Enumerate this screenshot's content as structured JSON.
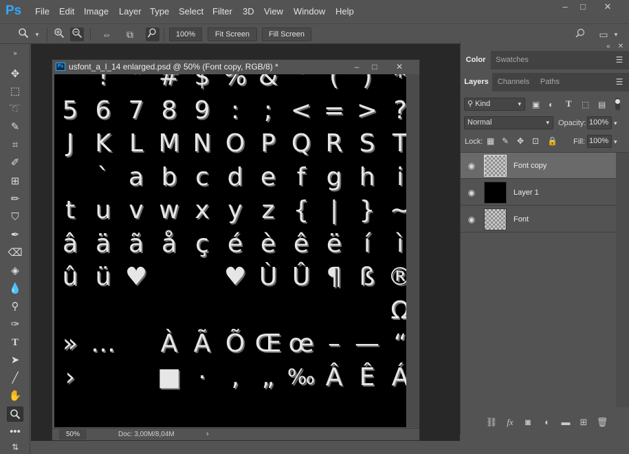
{
  "app": {
    "logo": "Ps"
  },
  "menu": [
    "File",
    "Edit",
    "Image",
    "Layer",
    "Type",
    "Select",
    "Filter",
    "3D",
    "View",
    "Window",
    "Help"
  ],
  "window_controls": [
    "–",
    "□",
    "✕"
  ],
  "options_bar": {
    "zoom_value": "100%",
    "fit_screen": "Fit Screen",
    "fill_screen": "Fill Screen"
  },
  "document": {
    "title": "usfont_a_l_14 enlarged.psd @ 50% (Font copy, RGB/8) *",
    "ps_icon": "Ps",
    "controls": [
      "–",
      "□",
      "✕"
    ],
    "status_zoom": "50%",
    "status_doc": "Doc: 3,00M/8,04M",
    "status_arrow": "›"
  },
  "glyph_rows": [
    [
      "",
      "!",
      "\"",
      "#",
      "$",
      "%",
      "&",
      "'",
      "(",
      ")",
      "*"
    ],
    [
      "5",
      "6",
      "7",
      "8",
      "9",
      ":",
      ";",
      "<",
      "=",
      ">",
      "?"
    ],
    [
      "J",
      "K",
      "L",
      "M",
      "N",
      "O",
      "P",
      "Q",
      "R",
      "S",
      "T"
    ],
    [
      "",
      "`",
      "a",
      "b",
      "c",
      "d",
      "e",
      "f",
      "g",
      "h",
      "i"
    ],
    [
      "t",
      "u",
      "v",
      "w",
      "x",
      "y",
      "z",
      "{",
      "|",
      "}",
      "~"
    ],
    [
      "â",
      "ä",
      "ã",
      "å",
      "ç",
      "é",
      "è",
      "ê",
      "ë",
      "í",
      "ì"
    ],
    [
      "û",
      "ü",
      "♥",
      "",
      "",
      "♥",
      "Ù",
      "Û",
      "¶",
      "ß",
      "®"
    ],
    [
      "",
      "",
      "",
      "",
      "",
      "",
      "",
      "",
      "",
      "",
      "Ω"
    ],
    [
      "»",
      "…",
      "",
      "À",
      "Ã",
      "Õ",
      "Œ",
      "œ",
      "–",
      "—",
      "“"
    ],
    [
      "›",
      "",
      "",
      "■",
      "·",
      "‚",
      "„",
      "‰",
      "Â",
      "Ê",
      "Á"
    ]
  ],
  "panels": {
    "top_tabs": [
      "Color",
      "Swatches"
    ],
    "layers_tabs": [
      "Layers",
      "Channels",
      "Paths"
    ],
    "filter_kind": "Kind",
    "blend_mode": "Normal",
    "opacity_label": "Opacity:",
    "opacity_value": "100%",
    "lock_label": "Lock:",
    "fill_label": "Fill:",
    "fill_value": "100%",
    "layers": [
      {
        "name": "Font copy",
        "thumb": "checker",
        "selected": true
      },
      {
        "name": "Layer 1",
        "thumb": "black",
        "selected": false
      },
      {
        "name": "Font",
        "thumb": "checker",
        "selected": false
      }
    ],
    "collapse_glyph": "«",
    "close_glyph": "✕"
  },
  "toolbox_icons": [
    "move-tool-icon",
    "marquee-tool-icon",
    "lasso-tool-icon",
    "quick-select-tool-icon",
    "crop-tool-icon",
    "eyedropper-tool-icon",
    "patch-tool-icon",
    "brush-tool-icon",
    "stamp-tool-icon",
    "history-brush-icon",
    "eraser-tool-icon",
    "paint-bucket-icon",
    "blur-tool-icon",
    "dodge-tool-icon",
    "pen-tool-icon",
    "type-tool-icon",
    "path-select-tool-icon",
    "line-tool-icon",
    "hand-tool-icon",
    "zoom-tool-icon",
    "more-tools-icon",
    "swap-colors-icon"
  ],
  "colors": {
    "ui_bg": "#535353",
    "workspace": "#282828",
    "canvas": "#000000",
    "accent": "#31a8ff",
    "selected_layer": "#6a6a6a"
  }
}
